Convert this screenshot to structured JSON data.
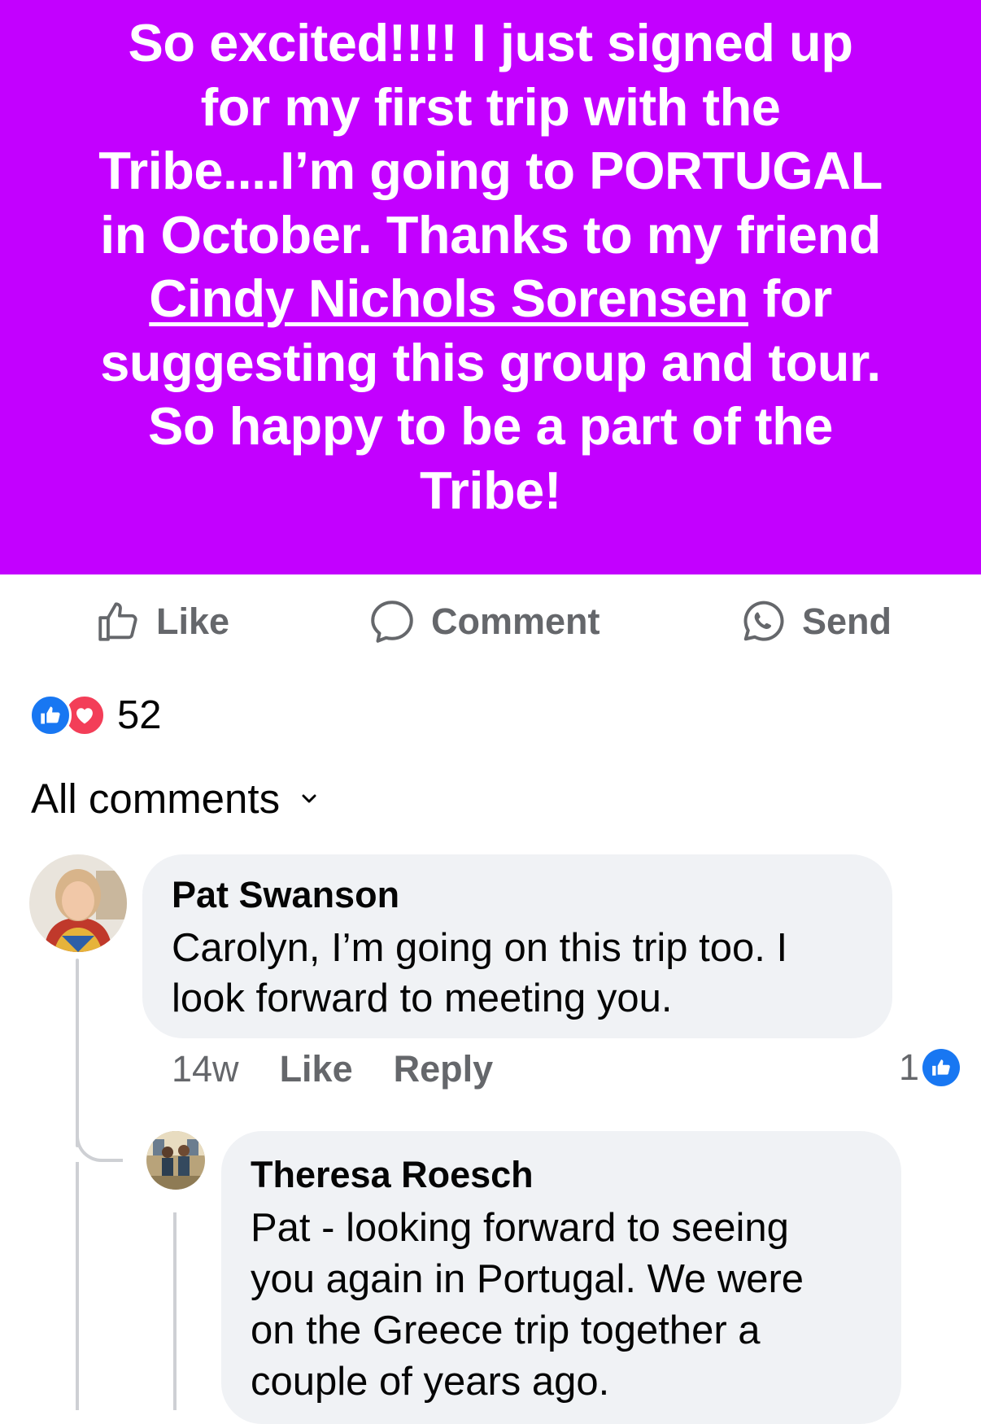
{
  "post": {
    "lines_before": [
      "So excited!!!!  I just signed up",
      "for my first trip with the",
      "Tribe....I’m going to PORTUGAL",
      "in October.  Thanks to my friend"
    ],
    "mention": "Cindy Nichols Sorensen",
    "after_mention": " for",
    "lines_after": [
      "suggesting this group and tour.",
      "So happy to be a part of the",
      "Tribe!"
    ],
    "background_color": "#c300ff"
  },
  "actions": {
    "like": "Like",
    "comment": "Comment",
    "send": "Send"
  },
  "reactions": {
    "icons": [
      "like-icon",
      "love-icon"
    ],
    "count": "52"
  },
  "comments_sort": {
    "label": "All comments"
  },
  "comments": [
    {
      "author": "Pat Swanson",
      "text_lines": [
        "Carolyn, I’m going on this trip too.  I",
        "look forward to meeting you."
      ],
      "time": "14w",
      "like": "Like",
      "reply": "Reply",
      "like_count": "1"
    }
  ],
  "replies": [
    {
      "author": "Theresa Roesch",
      "text_lines": [
        "Pat - looking forward to seeing",
        "you again in Portugal.   We were",
        "on the Greece trip together a",
        "couple of years ago."
      ]
    }
  ],
  "colors": {
    "banner": "#c300ff",
    "facebook_blue": "#1877f2",
    "love_red": "#f33e58",
    "bubble_gray": "#f0f2f5",
    "meta_gray": "#65676b"
  }
}
